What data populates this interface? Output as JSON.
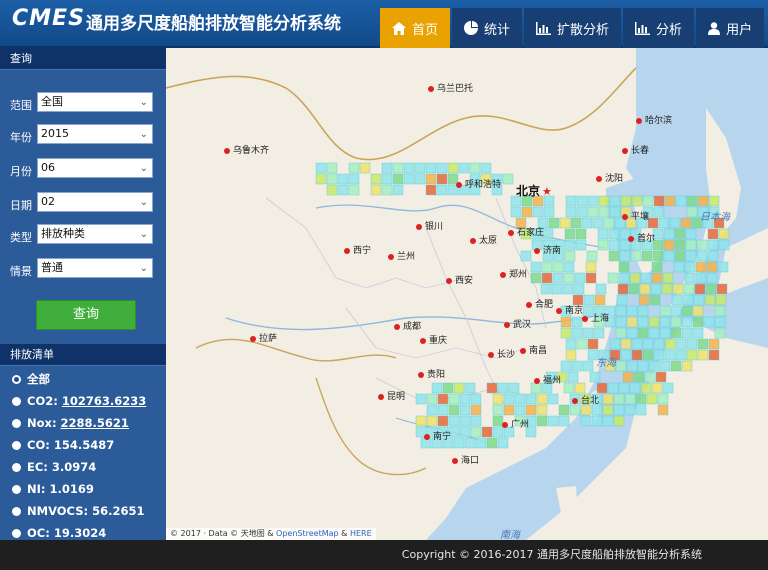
{
  "app": {
    "logo": "CMES",
    "title": "通用多尺度船舶排放智能分析系统"
  },
  "nav": [
    {
      "label": "首页",
      "icon": "home-icon",
      "active": true
    },
    {
      "label": "统计",
      "icon": "pie-chart-icon",
      "active": false
    },
    {
      "label": "扩散分析",
      "icon": "bar-chart-icon",
      "active": false
    },
    {
      "label": "分析",
      "icon": "bar-chart-icon",
      "active": false
    },
    {
      "label": "用户",
      "icon": "user-icon",
      "active": false
    }
  ],
  "query": {
    "header": "查询",
    "scope": {
      "label": "范围",
      "value": "全国"
    },
    "year": {
      "label": "年份",
      "value": "2015"
    },
    "month": {
      "label": "月份",
      "value": "06"
    },
    "day": {
      "label": "日期",
      "value": "02"
    },
    "type": {
      "label": "类型",
      "value": "排放种类"
    },
    "scenario": {
      "label": "情景",
      "value": "普通"
    },
    "button": "查询"
  },
  "emissions": {
    "header": "排放清单",
    "items": [
      {
        "name": "全部",
        "value": "",
        "selected": true
      },
      {
        "name": "CO2:",
        "value": "102763.6233",
        "selected": false
      },
      {
        "name": "Nox:",
        "value": "2288.5621",
        "selected": false
      },
      {
        "name": "CO:",
        "value": "154.5487",
        "selected": false
      },
      {
        "name": "EC:",
        "value": "3.0974",
        "selected": false
      },
      {
        "name": "NI:",
        "value": "1.0169",
        "selected": false
      },
      {
        "name": "NMVOCS:",
        "value": "56.2651",
        "selected": false
      },
      {
        "name": "OC:",
        "value": "19.3024",
        "selected": false
      }
    ]
  },
  "map": {
    "capital": "北京",
    "cities": [
      "乌兰巴托",
      "哈尔滨",
      "长春",
      "沈阳",
      "乌鲁木齐",
      "呼和浩特",
      "石家庄",
      "太原",
      "济南",
      "银川",
      "西宁",
      "兰州",
      "郑州",
      "西安",
      "合肥",
      "南京",
      "上海",
      "武汉",
      "成都",
      "重庆",
      "长沙",
      "南昌",
      "福州",
      "台北",
      "拉萨",
      "贵阳",
      "昆明",
      "南宁",
      "广州",
      "海口",
      "首尔",
      "平壤"
    ],
    "seas": [
      "日本海",
      "东海",
      "南海"
    ],
    "attribution": {
      "prefix": "© 2017 · Data © 天地图 & ",
      "link1": "OpenStreetMap",
      "mid": " & ",
      "link2": "HERE"
    }
  },
  "footer": "Copyright © 2016-2017 通用多尺度船舶排放智能分析系统"
}
